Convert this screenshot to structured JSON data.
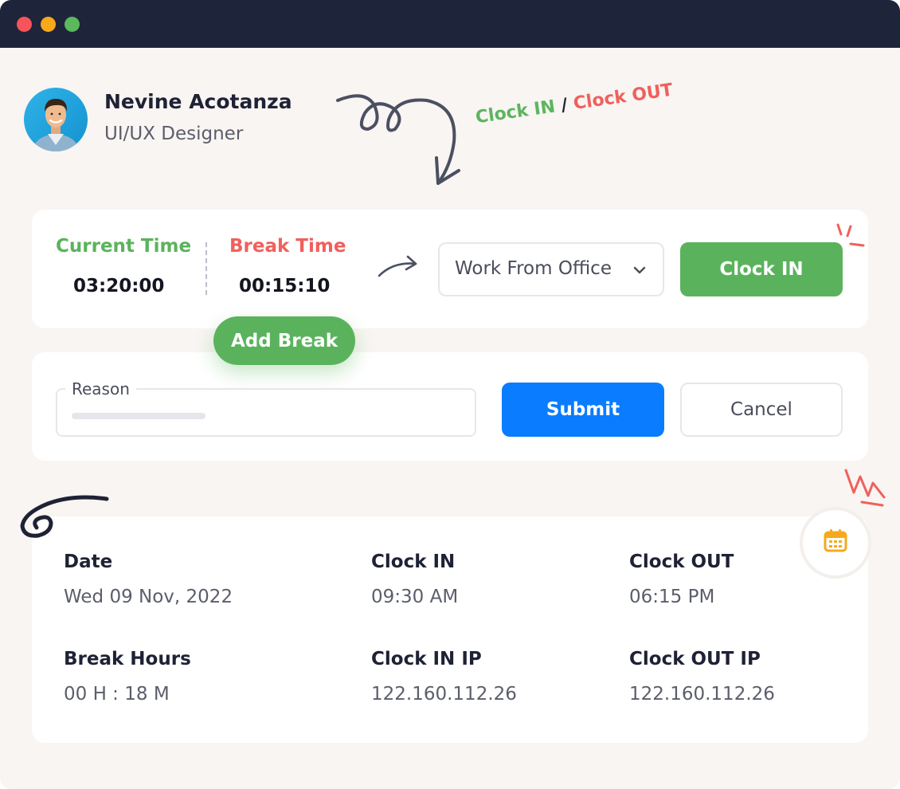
{
  "window": {
    "traffic_lights": [
      "close",
      "minimize",
      "maximize"
    ]
  },
  "profile": {
    "name": "Nevine Acotanza",
    "role": "UI/UX Designer",
    "avatar_icon": "user-avatar"
  },
  "annotation": {
    "clock_in": "Clock IN",
    "separator": "/",
    "clock_out": "Clock OUT"
  },
  "timer": {
    "current_time_label": "Current Time",
    "current_time_value": "03:20:00",
    "break_time_label": "Break Time",
    "break_time_value": "00:15:10"
  },
  "work_mode": {
    "selected": "Work From Office"
  },
  "actions": {
    "clock_in": "Clock IN",
    "add_break": "Add Break",
    "submit": "Submit",
    "cancel": "Cancel"
  },
  "reason": {
    "label": "Reason"
  },
  "details": {
    "date_label": "Date",
    "date_value": "Wed 09 Nov, 2022",
    "clock_in_label": "Clock IN",
    "clock_in_value": "09:30 AM",
    "clock_out_label": "Clock OUT",
    "clock_out_value": "06:15 PM",
    "break_hours_label": "Break Hours",
    "break_hours_value": "00 H : 18 M",
    "clock_in_ip_label": "Clock IN IP",
    "clock_in_ip_value": "122.160.112.26",
    "clock_out_ip_label": "Clock OUT IP",
    "clock_out_ip_value": "122.160.112.26"
  },
  "colors": {
    "green": "#5ab35c",
    "red": "#f0605c",
    "blue": "#0a7cff",
    "navy": "#1e243a",
    "orange": "#f7a91c",
    "background": "#f8f5f2"
  }
}
